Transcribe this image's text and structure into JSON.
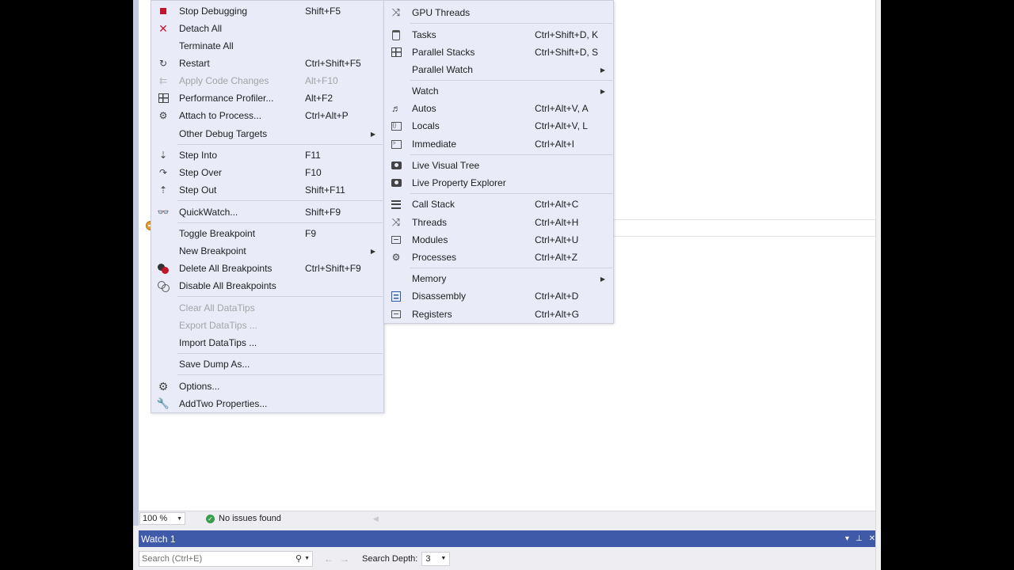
{
  "debug_menu": {
    "items": [
      {
        "name": "stop-debugging",
        "icon": "stop-icon",
        "label": "Stop Debugging",
        "shortcut": "Shift+F5",
        "enabled": true
      },
      {
        "name": "detach-all",
        "icon": "close-icon",
        "label": "Detach All",
        "shortcut": "",
        "enabled": true
      },
      {
        "name": "terminate-all",
        "icon": "",
        "label": "Terminate All",
        "shortcut": "",
        "enabled": true
      },
      {
        "name": "restart",
        "icon": "restart-icon",
        "label": "Restart",
        "shortcut": "Ctrl+Shift+F5",
        "enabled": true
      },
      {
        "name": "apply-code-changes",
        "icon": "apply-changes-icon",
        "label": "Apply Code Changes",
        "shortcut": "Alt+F10",
        "enabled": false
      },
      {
        "name": "performance-profiler",
        "icon": "profiler-icon",
        "label": "Performance Profiler...",
        "shortcut": "Alt+F2",
        "enabled": true
      },
      {
        "name": "attach-to-process",
        "icon": "attach-icon",
        "label": "Attach to Process...",
        "shortcut": "Ctrl+Alt+P",
        "enabled": true
      },
      {
        "name": "other-debug-targets",
        "icon": "",
        "label": "Other Debug Targets",
        "shortcut": "",
        "submenu": true,
        "enabled": true
      },
      {
        "name": "step-into",
        "icon": "step-into-icon",
        "label": "Step Into",
        "shortcut": "F11",
        "enabled": true
      },
      {
        "name": "step-over",
        "icon": "step-over-icon",
        "label": "Step Over",
        "shortcut": "F10",
        "enabled": true
      },
      {
        "name": "step-out",
        "icon": "step-out-icon",
        "label": "Step Out",
        "shortcut": "Shift+F11",
        "enabled": true
      },
      {
        "name": "quickwatch",
        "icon": "glasses-icon",
        "label": "QuickWatch...",
        "shortcut": "Shift+F9",
        "enabled": true
      },
      {
        "name": "toggle-breakpoint",
        "icon": "",
        "label": "Toggle Breakpoint",
        "shortcut": "F9",
        "enabled": true
      },
      {
        "name": "new-breakpoint",
        "icon": "",
        "label": "New Breakpoint",
        "shortcut": "",
        "submenu": true,
        "enabled": true
      },
      {
        "name": "delete-all-breakpoints",
        "icon": "delete-breakpoints-icon",
        "label": "Delete All Breakpoints",
        "shortcut": "Ctrl+Shift+F9",
        "enabled": true
      },
      {
        "name": "disable-all-breakpoints",
        "icon": "disable-breakpoints-icon",
        "label": "Disable All Breakpoints",
        "shortcut": "",
        "enabled": true
      },
      {
        "name": "clear-all-datatips",
        "icon": "",
        "label": "Clear All DataTips",
        "shortcut": "",
        "enabled": false
      },
      {
        "name": "export-datatips",
        "icon": "",
        "label": "Export DataTips ...",
        "shortcut": "",
        "enabled": false
      },
      {
        "name": "import-datatips",
        "icon": "",
        "label": "Import DataTips ...",
        "shortcut": "",
        "enabled": true
      },
      {
        "name": "save-dump-as",
        "icon": "",
        "label": "Save Dump As...",
        "shortcut": "",
        "enabled": true
      },
      {
        "name": "options",
        "icon": "gear-icon",
        "label": "Options...",
        "shortcut": "",
        "enabled": true
      },
      {
        "name": "addtwo-properties",
        "icon": "wrench-icon",
        "label": "AddTwo Properties...",
        "shortcut": "",
        "enabled": true
      }
    ]
  },
  "windows_menu": {
    "items": [
      {
        "name": "gpu-threads",
        "icon": "threads-icon",
        "label": "GPU Threads",
        "shortcut": ""
      },
      {
        "name": "tasks",
        "icon": "clipboard-icon",
        "label": "Tasks",
        "shortcut": "Ctrl+Shift+D, K"
      },
      {
        "name": "parallel-stacks",
        "icon": "parallel-stacks-icon",
        "label": "Parallel Stacks",
        "shortcut": "Ctrl+Shift+D, S"
      },
      {
        "name": "parallel-watch",
        "icon": "",
        "label": "Parallel Watch",
        "shortcut": "",
        "submenu": true
      },
      {
        "name": "watch",
        "icon": "",
        "label": "Watch",
        "shortcut": "",
        "submenu": true
      },
      {
        "name": "autos",
        "icon": "autos-icon",
        "label": "Autos",
        "shortcut": "Ctrl+Alt+V, A"
      },
      {
        "name": "locals",
        "icon": "locals-icon",
        "label": "Locals",
        "shortcut": "Ctrl+Alt+V, L"
      },
      {
        "name": "immediate",
        "icon": "terminal-icon",
        "label": "Immediate",
        "shortcut": "Ctrl+Alt+I"
      },
      {
        "name": "live-visual-tree",
        "icon": "camera-icon",
        "label": "Live Visual Tree",
        "shortcut": ""
      },
      {
        "name": "live-property-explorer",
        "icon": "camera-icon",
        "label": "Live Property Explorer",
        "shortcut": ""
      },
      {
        "name": "call-stack",
        "icon": "call-stack-icon",
        "label": "Call Stack",
        "shortcut": "Ctrl+Alt+C"
      },
      {
        "name": "threads",
        "icon": "threads-icon",
        "label": "Threads",
        "shortcut": "Ctrl+Alt+H"
      },
      {
        "name": "modules",
        "icon": "modules-icon",
        "label": "Modules",
        "shortcut": "Ctrl+Alt+U"
      },
      {
        "name": "processes",
        "icon": "processes-icon",
        "label": "Processes",
        "shortcut": "Ctrl+Alt+Z"
      },
      {
        "name": "memory",
        "icon": "",
        "label": "Memory",
        "shortcut": "",
        "submenu": true
      },
      {
        "name": "disassembly",
        "icon": "disassembly-icon",
        "label": "Disassembly",
        "shortcut": "Ctrl+Alt+D"
      },
      {
        "name": "registers",
        "icon": "registers-icon",
        "label": "Registers",
        "shortcut": "Ctrl+Alt+G"
      }
    ]
  },
  "status": {
    "zoom": "100 %",
    "issues": "No issues found"
  },
  "watch_window": {
    "title": "Watch 1",
    "search_placeholder": "Search (Ctrl+E)",
    "search_depth_label": "Search Depth:",
    "search_depth_value": "3"
  },
  "colors": {
    "menu_bg": "#e9ebf9",
    "watch_title_bg": "#3f5aa8",
    "disabled_text": "#a2a4a5",
    "breakpoint": "#e8a033"
  }
}
